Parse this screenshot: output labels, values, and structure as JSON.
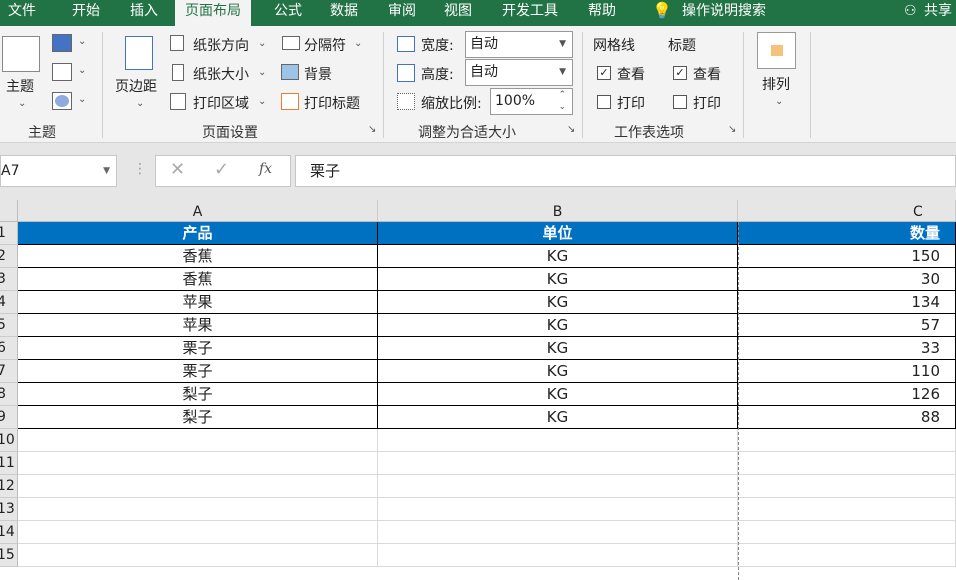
{
  "tabs": [
    "文件",
    "开始",
    "插入",
    "页面布局",
    "公式",
    "数据",
    "审阅",
    "视图",
    "开发工具",
    "帮助"
  ],
  "tell_me": "操作说明搜索",
  "share": "共享",
  "ribbon": {
    "theme_btn": "主题",
    "theme_group": "主题",
    "margins": "页边距",
    "orientation": "纸张方向",
    "size": "纸张大小",
    "print_area": "打印区域",
    "breaks": "分隔符",
    "background": "背景",
    "print_titles": "打印标题",
    "page_setup_group": "页面设置",
    "width_label": "宽度:",
    "width_value": "自动",
    "height_label": "高度:",
    "height_value": "自动",
    "scale_label": "缩放比例:",
    "scale_value": "100%",
    "scale_group": "调整为合适大小",
    "gridlines": "网格线",
    "headings": "标题",
    "view": "查看",
    "print": "打印",
    "sheet_options_group": "工作表选项",
    "arrange": "排列"
  },
  "formula": {
    "name_box": "A7",
    "fx": "fx",
    "content": "栗子"
  },
  "columns": [
    "A",
    "B",
    "C"
  ],
  "row_numbers": [
    "1",
    "2",
    "3",
    "4",
    "5",
    "6",
    "7",
    "8",
    "9",
    "10",
    "11",
    "12",
    "13",
    "14",
    "15"
  ],
  "header_row": [
    "产品",
    "单位",
    "数量"
  ],
  "rows": [
    [
      "香蕉",
      "KG",
      "150"
    ],
    [
      "香蕉",
      "KG",
      "30"
    ],
    [
      "苹果",
      "KG",
      "134"
    ],
    [
      "苹果",
      "KG",
      "57"
    ],
    [
      "栗子",
      "KG",
      "33"
    ],
    [
      "栗子",
      "KG",
      "110"
    ],
    [
      "梨子",
      "KG",
      "126"
    ],
    [
      "梨子",
      "KG",
      "88"
    ]
  ],
  "colors": {
    "excel_green": "#217346",
    "header_fill": "#0070c0"
  }
}
